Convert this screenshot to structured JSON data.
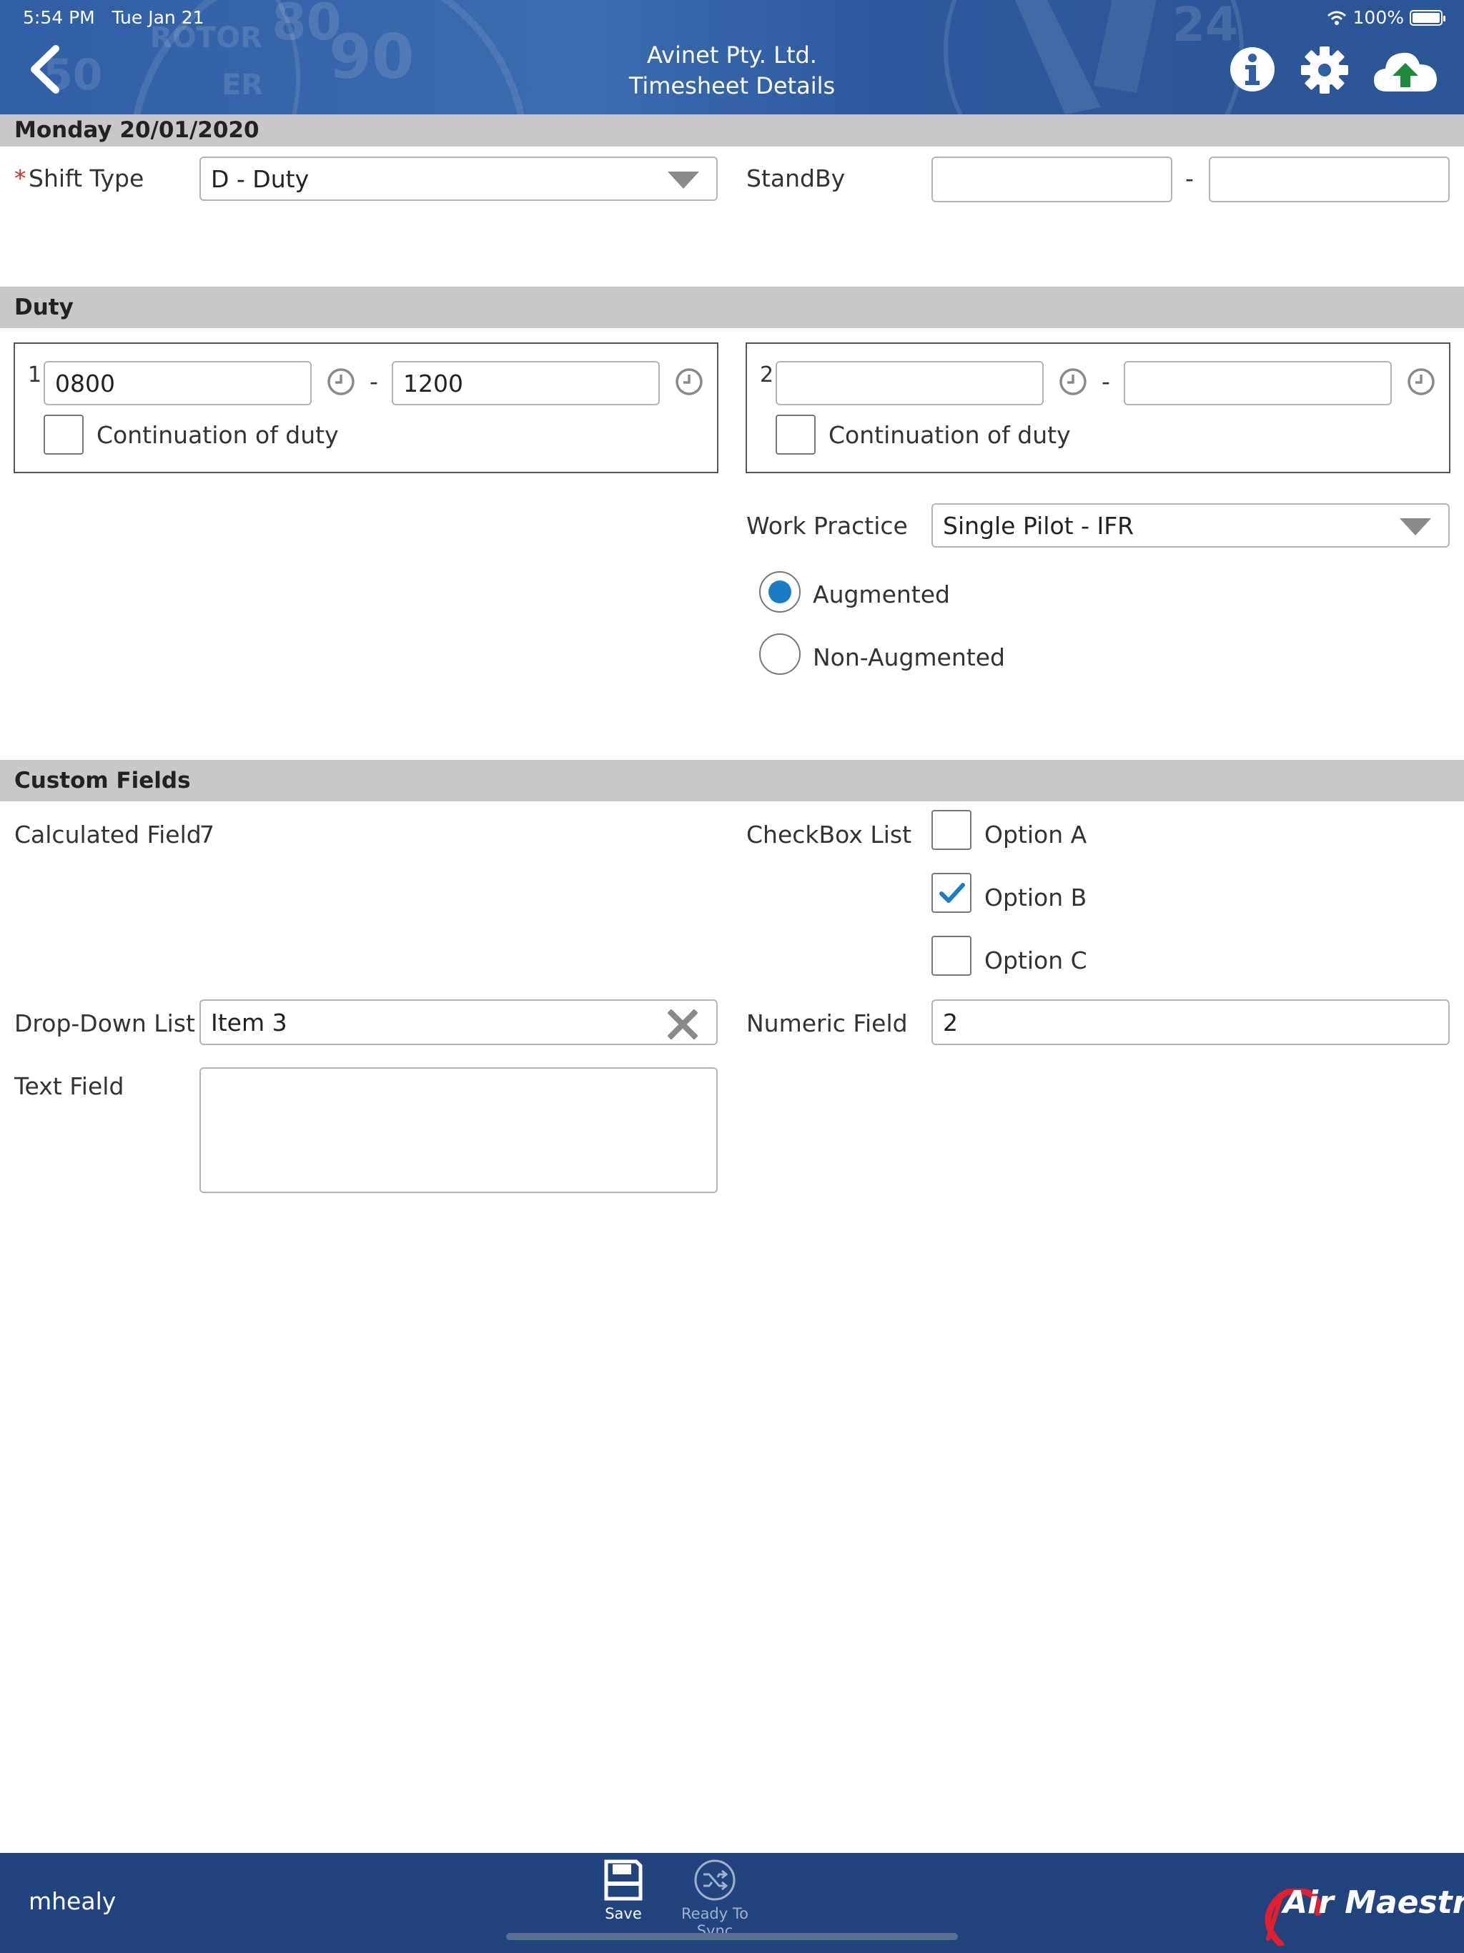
{
  "status_bar": {
    "time": "5:54 PM",
    "date": "Tue Jan 21",
    "battery": "100%"
  },
  "header": {
    "company": "Avinet Pty. Ltd.",
    "title": "Timesheet Details",
    "background_text": [
      "ROTOR",
      "90",
      "ER",
      "24",
      "80",
      "50"
    ]
  },
  "date_bar": {
    "label": "Monday 20/01/2020"
  },
  "shift": {
    "required_mark": "*",
    "label": "Shift Type",
    "value": "D - Duty",
    "standby_label": "StandBy",
    "standby_from": "",
    "standby_to": "",
    "dash": "-"
  },
  "duty": {
    "section_title": "Duty",
    "blocks": [
      {
        "index": "1",
        "start": "0800",
        "end": "1200",
        "continuation_label": "Continuation of duty",
        "continuation_checked": false
      },
      {
        "index": "2",
        "start": "",
        "end": "",
        "continuation_label": "Continuation of duty",
        "continuation_checked": false
      }
    ],
    "work_practice_label": "Work Practice",
    "work_practice_value": "Single Pilot - IFR",
    "augmented_label": "Augmented",
    "non_augmented_label": "Non-Augmented",
    "selected": "Augmented"
  },
  "custom_fields": {
    "section_title": "Custom Fields",
    "calculated_label": "Calculated Field",
    "calculated_value": "7",
    "checkbox_list_label": "CheckBox List",
    "options": [
      {
        "label": "Option A",
        "checked": false
      },
      {
        "label": "Option B",
        "checked": true
      },
      {
        "label": "Option C",
        "checked": false
      }
    ],
    "dropdown_label": "Drop-Down List",
    "dropdown_value": "Item 3",
    "numeric_label": "Numeric Field",
    "numeric_value": "2",
    "text_label": "Text Field",
    "text_value": ""
  },
  "footer": {
    "user": "mhealy",
    "save_label": "Save",
    "sync_label": "Ready To Sync",
    "logo_text": "Air Maestro"
  },
  "colors": {
    "header_blue": "#2f5fa5",
    "footer_blue": "#22447e",
    "section_gray": "#c8c8cb",
    "accent_blue": "#1a7ec4",
    "upload_green": "#1e8a3c",
    "required_red": "#d0312d",
    "logo_red": "#e0202e"
  }
}
